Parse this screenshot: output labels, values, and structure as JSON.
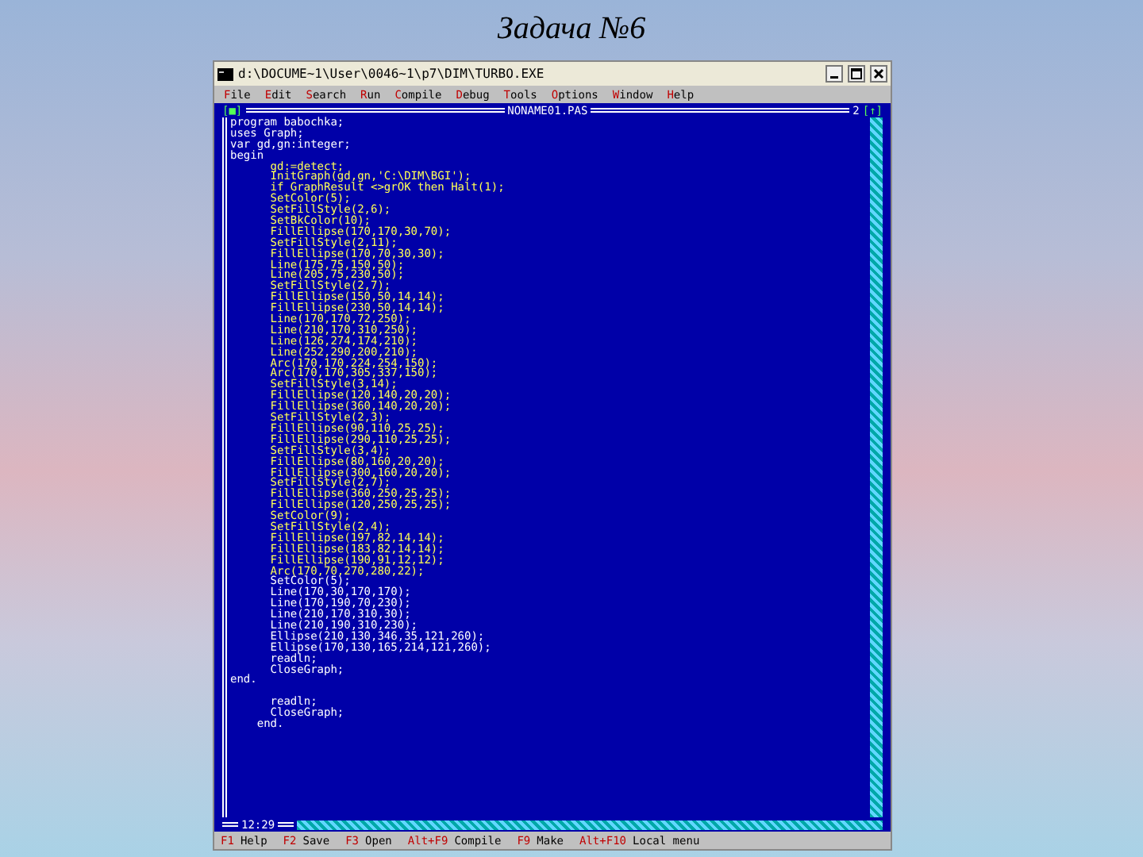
{
  "slide": {
    "title": "Задача №6"
  },
  "window": {
    "title": "d:\\DOCUME~1\\User\\0046~1\\p7\\DIM\\TURBO.EXE"
  },
  "menu": [
    {
      "label": "File"
    },
    {
      "label": "Edit"
    },
    {
      "label": "Search"
    },
    {
      "label": "Run"
    },
    {
      "label": "Compile"
    },
    {
      "label": "Debug"
    },
    {
      "label": "Tools"
    },
    {
      "label": "Options"
    },
    {
      "label": "Window"
    },
    {
      "label": "Help"
    }
  ],
  "editor": {
    "close_mark": "[■]",
    "file_name": "NONAME01.PAS",
    "window_number": "2",
    "zoom_mark": "[↑]",
    "cursor_position": "12:29",
    "lines": [
      {
        "text": "program babochka;",
        "highlighted": false
      },
      {
        "text": "uses Graph;",
        "highlighted": false
      },
      {
        "text": "var gd,gn:integer;",
        "highlighted": false
      },
      {
        "text": "begin",
        "highlighted": false
      },
      {
        "text": "      gd:=detect;",
        "highlighted": true
      },
      {
        "text": "      InitGraph(gd,gn,'C:\\DIM\\BGI');",
        "highlighted": true
      },
      {
        "text": "      if GraphResult <>grOK then Halt(1);",
        "highlighted": true
      },
      {
        "text": "      SetColor(5);",
        "highlighted": true
      },
      {
        "text": "      SetFillStyle(2,6);",
        "highlighted": true
      },
      {
        "text": "      SetBkColor(10);",
        "highlighted": true
      },
      {
        "text": "      FillEllipse(170,170,30,70);",
        "highlighted": true
      },
      {
        "text": "      SetFillStyle(2,11);",
        "highlighted": true
      },
      {
        "text": "      FillEllipse(170,70,30,30);",
        "highlighted": true
      },
      {
        "text": "      Line(175,75,150,50);",
        "highlighted": true
      },
      {
        "text": "      Line(205,75,230,50);",
        "highlighted": true
      },
      {
        "text": "      SetFillStyle(2,7);",
        "highlighted": true
      },
      {
        "text": "      FillEllipse(150,50,14,14);",
        "highlighted": true
      },
      {
        "text": "      FillEllipse(230,50,14,14);",
        "highlighted": true
      },
      {
        "text": "      Line(170,170,72,250);",
        "highlighted": true
      },
      {
        "text": "      Line(210,170,310,250);",
        "highlighted": true
      },
      {
        "text": "      Line(126,274,174,210);",
        "highlighted": true
      },
      {
        "text": "      Line(252,290,200,210);",
        "highlighted": true
      },
      {
        "text": "      Arc(170,170,224,254,150);",
        "highlighted": true
      },
      {
        "text": "      Arc(170,170,305,337,150);",
        "highlighted": true
      },
      {
        "text": "      SetFillStyle(3,14);",
        "highlighted": true
      },
      {
        "text": "      FillEllipse(120,140,20,20);",
        "highlighted": true
      },
      {
        "text": "      FillEllipse(360,140,20,20);",
        "highlighted": true
      },
      {
        "text": "      SetFillStyle(2,3);",
        "highlighted": true
      },
      {
        "text": "      FillEllipse(90,110,25,25);",
        "highlighted": true
      },
      {
        "text": "      FillEllipse(290,110,25,25);",
        "highlighted": true
      },
      {
        "text": "      SetFillStyle(3,4);",
        "highlighted": true
      },
      {
        "text": "      FillEllipse(80,160,20,20);",
        "highlighted": true
      },
      {
        "text": "      FillEllipse(300,160,20,20);",
        "highlighted": true
      },
      {
        "text": "      SetFillStyle(2,7);",
        "highlighted": true
      },
      {
        "text": "      FillEllipse(360,250,25,25);",
        "highlighted": true
      },
      {
        "text": "      FillEllipse(120,250,25,25);",
        "highlighted": true
      },
      {
        "text": "      SetColor(9);",
        "highlighted": true
      },
      {
        "text": "      SetFillStyle(2,4);",
        "highlighted": true
      },
      {
        "text": "      FillEllipse(197,82,14,14);",
        "highlighted": true
      },
      {
        "text": "      FillEllipse(183,82,14,14);",
        "highlighted": true
      },
      {
        "text": "      FillEllipse(190,91,12,12);",
        "highlighted": true
      },
      {
        "text": "      Arc(170,70,270,280,22);",
        "highlighted": true
      },
      {
        "text": "      SetColor(5);",
        "highlighted": false
      },
      {
        "text": "      Line(170,30,170,170);",
        "highlighted": false
      },
      {
        "text": "      Line(170,190,70,230);",
        "highlighted": false
      },
      {
        "text": "      Line(210,170,310,30);",
        "highlighted": false
      },
      {
        "text": "      Line(210,190,310,230);",
        "highlighted": false
      },
      {
        "text": "      Ellipse(210,130,346,35,121,260);",
        "highlighted": false
      },
      {
        "text": "      Ellipse(170,130,165,214,121,260);",
        "highlighted": false
      },
      {
        "text": "      readln;",
        "highlighted": false
      },
      {
        "text": "      CloseGraph;",
        "highlighted": false
      },
      {
        "text": "end.",
        "highlighted": false
      },
      {
        "text": "      readln;",
        "highlighted": false,
        "blank_before": true
      },
      {
        "text": "      CloseGraph;",
        "highlighted": false
      },
      {
        "text": "    end.",
        "highlighted": false
      }
    ]
  },
  "status_bar": [
    {
      "key": "F1",
      "label": "Help"
    },
    {
      "key": "F2",
      "label": "Save"
    },
    {
      "key": "F3",
      "label": "Open"
    },
    {
      "key": "Alt+F9",
      "label": "Compile"
    },
    {
      "key": "F9",
      "label": "Make"
    },
    {
      "key": "Alt+F10",
      "label": "Local menu"
    }
  ]
}
